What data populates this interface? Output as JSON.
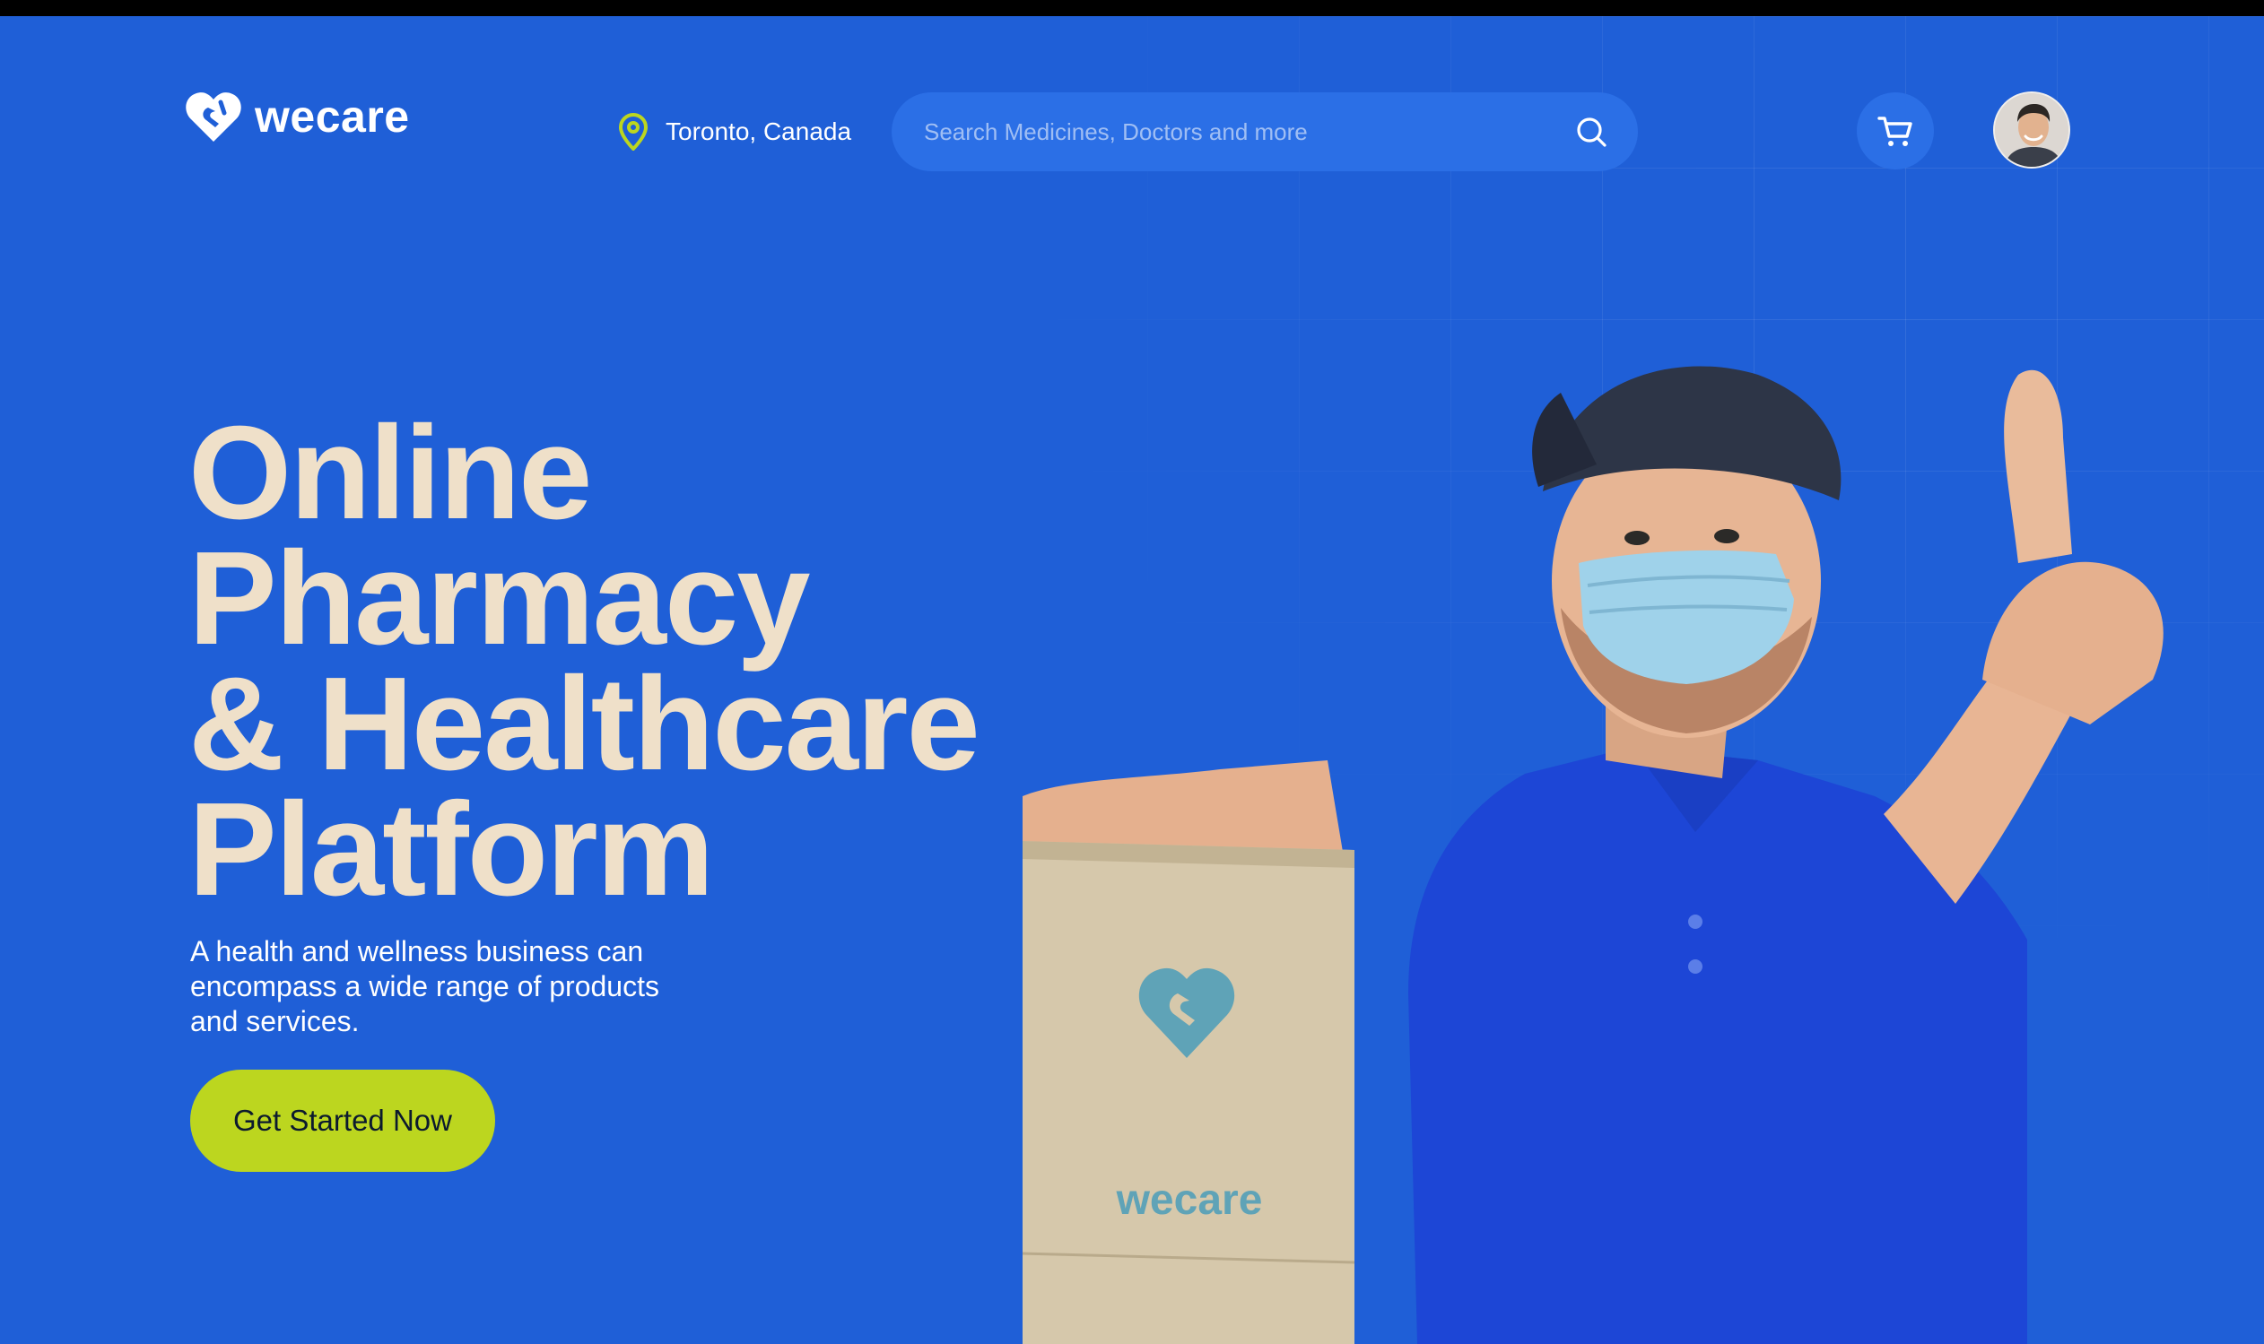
{
  "brand": {
    "name": "wecare",
    "box_logo_text": "wecare"
  },
  "header": {
    "location": "Toronto, Canada",
    "search": {
      "placeholder": "Search Medicines, Doctors and more",
      "value": ""
    }
  },
  "hero": {
    "headline": [
      "Online",
      "Pharmacy",
      "& Healthcare",
      "Platform"
    ],
    "description": "A health and wellness business can encompass a wide range of products and services.",
    "cta_label": "Get Started Now"
  },
  "colors": {
    "background": "#1f5fd7",
    "search_bg": "#2b6fe6",
    "headline": "#efe0c9",
    "cta": "#bcd61f",
    "pin_accent": "#bcd61f"
  },
  "icons": [
    "logo-heart-icon",
    "location-pin-icon",
    "search-icon",
    "cart-icon",
    "avatar"
  ]
}
